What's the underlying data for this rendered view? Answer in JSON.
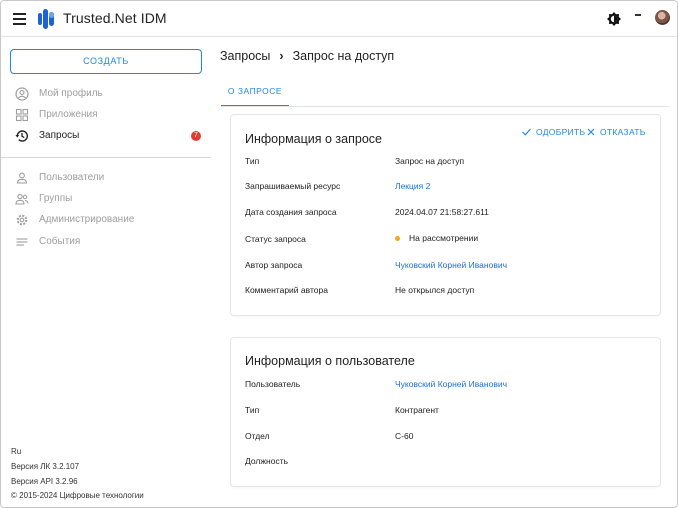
{
  "app": {
    "title": "Trusted.Net IDM"
  },
  "sidebar": {
    "create_label": "СОЗДАТЬ",
    "items": [
      {
        "label": "Мой профиль",
        "icon": "profile-icon"
      },
      {
        "label": "Приложения",
        "icon": "apps-icon"
      },
      {
        "label": "Запросы",
        "icon": "history-icon",
        "badge": "7",
        "active": true
      },
      {
        "label": "Пользователи",
        "icon": "user-icon"
      },
      {
        "label": "Группы",
        "icon": "group-icon"
      },
      {
        "label": "Администрирование",
        "icon": "settings-icon"
      },
      {
        "label": "События",
        "icon": "events-icon"
      }
    ],
    "footer": {
      "lang": "Ru",
      "version_lk": "Версия ЛК 3.2.107",
      "version_api": "Версия API 3.2.96",
      "copyright": "© 2015-2024 Цифровые технологии"
    }
  },
  "breadcrumb": {
    "parent": "Запросы",
    "current": "Запрос на доступ"
  },
  "tabs": [
    {
      "label": "О ЗАПРОСЕ",
      "active": true
    }
  ],
  "request_card": {
    "title": "Информация о запросе",
    "approve_label": "ОДОБРИТЬ",
    "reject_label": "ОТКАЗАТЬ",
    "rows": [
      {
        "label": "Тип",
        "value": "Запрос на доступ"
      },
      {
        "label": "Запрашиваемый ресурс",
        "value": "Лекция 2"
      },
      {
        "label": "Дата создания запроса",
        "value": "2024.04.07 21:58:27.611"
      },
      {
        "label": "Статус запроса",
        "value": "На рассмотрении"
      },
      {
        "label": "Автор запроса",
        "value": "Чуковский Корней Иванович"
      },
      {
        "label": "Комментарий автора",
        "value": "Не открылся доступ"
      }
    ]
  },
  "user_card": {
    "title": "Информация о пользователе",
    "rows": [
      {
        "label": "Пользователь",
        "value": "Чуковский Корней Иванович"
      },
      {
        "label": "Тип",
        "value": "Контрагент"
      },
      {
        "label": "Отдел",
        "value": "С-60"
      },
      {
        "label": "Должность",
        "value": ""
      }
    ]
  },
  "colors": {
    "accent": "#1e88e5",
    "link": "#1e6fd9",
    "badge": "#e53935",
    "status_pending": "#f5a623"
  }
}
